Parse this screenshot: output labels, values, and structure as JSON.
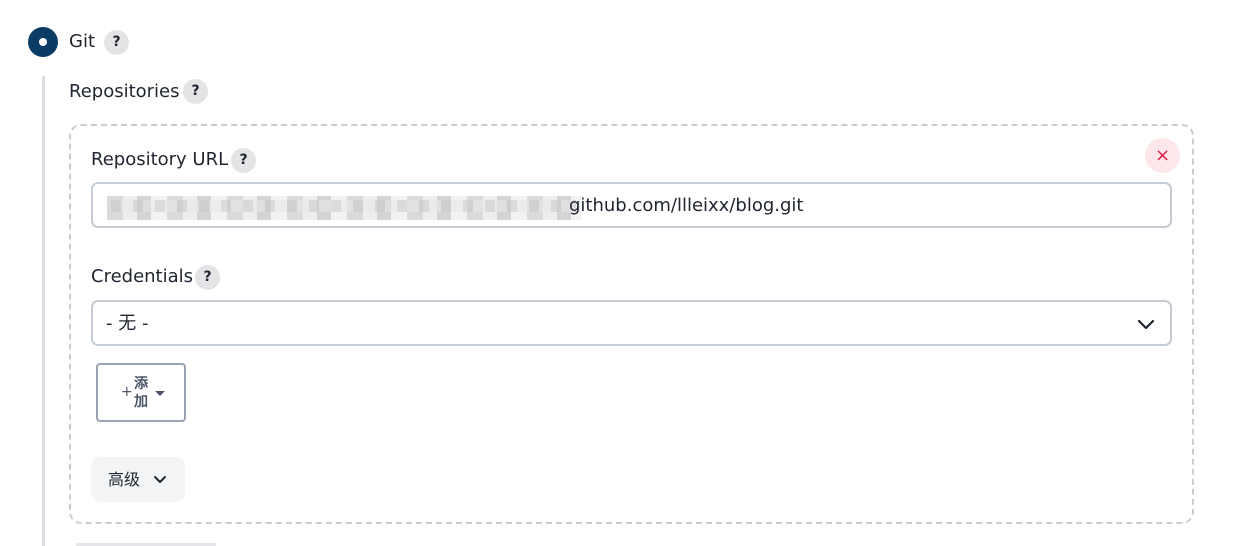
{
  "scm": {
    "option_label": "Git",
    "help_icon": "?"
  },
  "repositories": {
    "label": "Repositories",
    "help_icon": "?",
    "url_label": "Repository URL",
    "url_help": "?",
    "url_value": "github.com/llleixx/blog.git",
    "credentials_label": "Credentials",
    "credentials_help": "?",
    "credentials_value": "- 无 -",
    "add_button_label": "添加",
    "advanced_button_label": "高级",
    "close_icon": "×"
  },
  "icons": {
    "radio": "radio-selected",
    "help": "help-icon",
    "close": "close-icon",
    "chevron": "chevron-down-icon",
    "plus": "plus-icon",
    "caret": "caret-down-icon"
  }
}
